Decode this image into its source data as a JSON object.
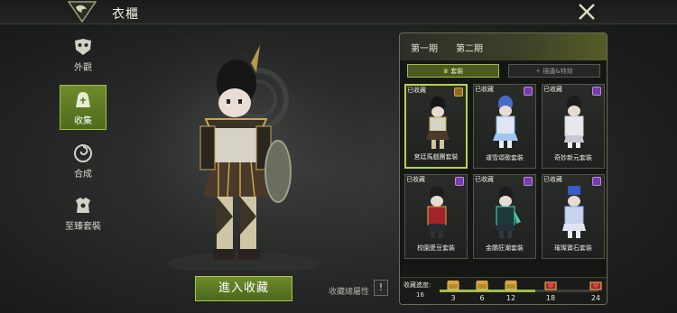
{
  "header": {
    "title": "衣櫃"
  },
  "sidebar": {
    "items": [
      {
        "label": "外觀",
        "icon": "mask-icon",
        "active": false
      },
      {
        "label": "收集",
        "icon": "collection-bag-icon",
        "active": true
      },
      {
        "label": "合成",
        "icon": "swirl-icon",
        "active": false
      },
      {
        "label": "至臻套裝",
        "icon": "armor-icon",
        "active": false
      }
    ]
  },
  "main": {
    "enter_button": "進入收藏",
    "attr_label": "收藏總屬性",
    "attr_button": "!"
  },
  "panel": {
    "tabs": [
      "第一期",
      "第二期"
    ],
    "subtabs": [
      "套裝",
      "描邊&特效"
    ],
    "cards": [
      {
        "tag": "已收藏",
        "name": "宮廷馬戲團套裝",
        "badge": "gold",
        "selected": true
      },
      {
        "tag": "已收藏",
        "name": "運雪頌歌套裝",
        "badge": "purple",
        "selected": false
      },
      {
        "tag": "已收藏",
        "name": "奇妙新元套裝",
        "badge": "purple",
        "selected": false
      },
      {
        "tag": "已收藏",
        "name": "校園愛豆套裝",
        "badge": "purple",
        "selected": false
      },
      {
        "tag": "已收藏",
        "name": "金鵰狂潮套裝",
        "badge": "purple",
        "selected": false
      },
      {
        "tag": "已收藏",
        "name": "璀璨寶石套裝",
        "badge": "purple",
        "selected": false
      }
    ],
    "progress": {
      "label": "收藏進度:",
      "value": "16",
      "fill_fraction": 0.6,
      "milestones": [
        "3",
        "6",
        "12",
        "18",
        "24"
      ]
    }
  },
  "colors": {
    "accent": "#9fbd48",
    "button": "#5f7a22",
    "badge_purple": "#7a3aa8"
  }
}
